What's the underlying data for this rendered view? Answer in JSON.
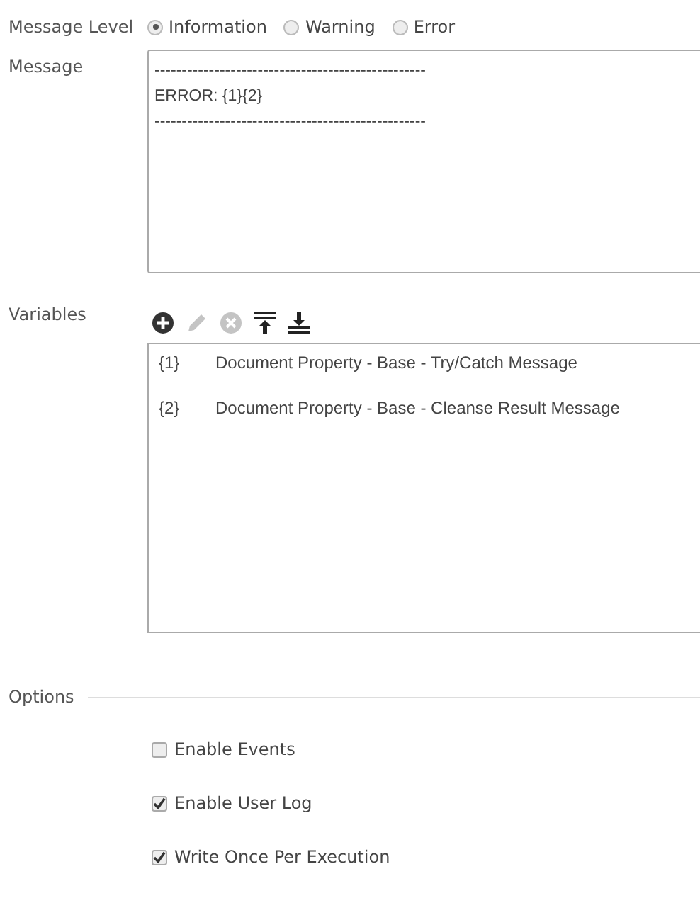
{
  "message_level": {
    "label": "Message Level",
    "options": [
      {
        "label": "Information",
        "selected": true
      },
      {
        "label": "Warning",
        "selected": false
      },
      {
        "label": "Error",
        "selected": false
      }
    ]
  },
  "message": {
    "label": "Message",
    "lines": [
      "--------------------------------------------------",
      "ERROR: {1}{2}",
      "--------------------------------------------------"
    ]
  },
  "variables": {
    "label": "Variables",
    "toolbar": [
      {
        "kind": "add",
        "disabled": false
      },
      {
        "kind": "edit",
        "disabled": true
      },
      {
        "kind": "remove",
        "disabled": true
      },
      {
        "kind": "move-top",
        "disabled": false
      },
      {
        "kind": "move-bottom",
        "disabled": false
      }
    ],
    "rows": [
      {
        "key": "{1}",
        "value": "Document Property - Base - Try/Catch Message"
      },
      {
        "key": "{2}",
        "value": "Document Property - Base - Cleanse Result Message"
      }
    ]
  },
  "options": {
    "title": "Options",
    "items": [
      {
        "label": "Enable Events",
        "checked": false
      },
      {
        "label": "Enable User Log",
        "checked": true
      },
      {
        "label": "Write Once Per Execution",
        "checked": true
      }
    ]
  }
}
